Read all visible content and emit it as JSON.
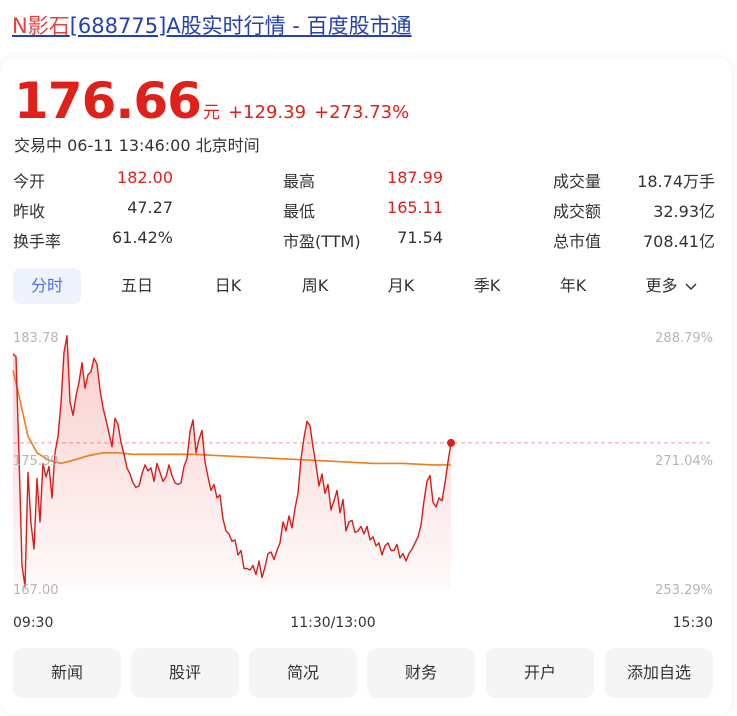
{
  "page": {
    "link_brand": "N影石",
    "link_rest": "[688775]A股实时行情 - 百度股市通"
  },
  "quote": {
    "price": "176.66",
    "unit": "元",
    "change": "+129.39",
    "change_pct": "+273.73%",
    "status": "交易中 06-11 13:46:00 北京时间"
  },
  "stats": [
    {
      "label": "今开",
      "value": "182.00"
    },
    {
      "label": "最高",
      "value": "187.99"
    },
    {
      "label": "成交量",
      "value": "18.74万手"
    },
    {
      "label": "昨收",
      "value": "47.27"
    },
    {
      "label": "最低",
      "value": "165.11"
    },
    {
      "label": "成交额",
      "value": "32.93亿"
    },
    {
      "label": "换手率",
      "value": "61.42%"
    },
    {
      "label": "市盈(TTM)",
      "value": "71.54"
    },
    {
      "label": "总市值",
      "value": "708.41亿"
    }
  ],
  "tabs": [
    "分时",
    "五日",
    "日K",
    "周K",
    "月K",
    "季K",
    "年K",
    "更多"
  ],
  "active_tab": "分时",
  "more_icon": "chevron-down-icon",
  "buttons": [
    "新闻",
    "股评",
    "简况",
    "财务",
    "开户",
    "添加自选"
  ],
  "colors": {
    "up": "#e0201b",
    "link": "#2440b3",
    "brand": "#e7413d",
    "avg_line": "#ee7d1f",
    "tab_active": "#4e6ef2",
    "tab_active_bg": "#eef3fe"
  },
  "chart_data": {
    "type": "line",
    "x_ticks": [
      "09:30",
      "11:30/13:00",
      "15:30"
    ],
    "y_left_ticks": [
      "183.78",
      "175.39",
      "167.00"
    ],
    "y_right_ticks": [
      "288.79%",
      "271.04%",
      "253.29%"
    ],
    "ylim": [
      167.0,
      183.78
    ],
    "reference_line": 175.39,
    "last_value": 176.66,
    "series": [
      {
        "kind": "price",
        "x": [
          0,
          1,
          2,
          3,
          4,
          5,
          6,
          7,
          8,
          9,
          10,
          11,
          12,
          13,
          14,
          15,
          16,
          17,
          18,
          19,
          20,
          21,
          22,
          23,
          24,
          25,
          26,
          27,
          28,
          29,
          30,
          31,
          32,
          33,
          34,
          35,
          36,
          37,
          38,
          39,
          40,
          41,
          42,
          43,
          44,
          45,
          46,
          47,
          48,
          49,
          50,
          51,
          52,
          53,
          54,
          55,
          56,
          57,
          58,
          59,
          60,
          61,
          62,
          63,
          64,
          65,
          66,
          67,
          68,
          69,
          70,
          71,
          72,
          73,
          74,
          75,
          76,
          77,
          78,
          79,
          80,
          81,
          82,
          83,
          84,
          85,
          86,
          87,
          88,
          89,
          90,
          91,
          92,
          93,
          94,
          95,
          96,
          97,
          98,
          99,
          100,
          101,
          102,
          103,
          104,
          105,
          106,
          107,
          108,
          109,
          110,
          111,
          112,
          113,
          114,
          115,
          116,
          117,
          118,
          119,
          120,
          121,
          122,
          123,
          124,
          125,
          126,
          127,
          128,
          129,
          130,
          131,
          132,
          133,
          134,
          135,
          136,
          137,
          138,
          139,
          140,
          141,
          142,
          143,
          144,
          145,
          146
        ],
        "values": [
          182.6,
          182.4,
          175.8,
          168.5,
          167.1,
          174.7,
          171.3,
          169.6,
          174.3,
          171.4,
          175.3,
          174.4,
          175.1,
          173.0,
          176.0,
          177.1,
          179.3,
          182.7,
          183.8,
          179.4,
          178.5,
          179.8,
          180.7,
          182.0,
          180.3,
          181.2,
          181.4,
          182.3,
          181.9,
          180.2,
          179.0,
          178.2,
          177.3,
          176.4,
          178.3,
          177.9,
          176.7,
          175.9,
          175.0,
          174.6,
          174.0,
          173.7,
          173.8,
          174.6,
          175.2,
          174.8,
          175.0,
          174.1,
          175.3,
          174.7,
          174.1,
          174.4,
          175.2,
          174.5,
          174.0,
          173.9,
          174.0,
          175.1,
          175.6,
          177.4,
          178.2,
          176.0,
          176.9,
          177.5,
          175.4,
          174.4,
          173.5,
          173.9,
          173.0,
          173.2,
          171.6,
          170.8,
          170.6,
          170.1,
          170.2,
          169.2,
          169.5,
          168.3,
          168.3,
          168.2,
          168.5,
          167.9,
          168.8,
          167.7,
          168.4,
          169.3,
          169.4,
          168.9,
          169.5,
          170.0,
          171.4,
          170.8,
          171.8,
          171.0,
          172.3,
          173.3,
          175.6,
          177.0,
          178.1,
          177.8,
          176.4,
          175.2,
          173.8,
          174.6,
          173.3,
          173.9,
          172.2,
          172.8,
          173.5,
          172.0,
          172.9,
          170.8,
          171.4,
          171.5,
          170.7,
          170.8,
          171.1,
          170.6,
          171.1,
          170.2,
          170.4,
          169.8,
          170.0,
          169.2,
          169.8,
          170.0,
          169.5,
          169.5,
          169.9,
          169.0,
          169.3,
          168.8,
          169.3,
          169.6,
          170.0,
          170.4,
          171.2,
          172.8,
          174.1,
          174.5,
          172.7,
          172.4,
          173.0,
          172.8,
          174.0,
          175.4,
          176.66
        ]
      },
      {
        "kind": "average",
        "x": [
          0,
          2,
          5,
          8,
          12,
          16,
          20,
          25,
          30,
          35,
          40,
          50,
          60,
          70,
          80,
          90,
          100,
          110,
          120,
          130,
          140,
          146
        ],
        "values": [
          181.5,
          179.8,
          177.1,
          176.0,
          175.5,
          175.3,
          175.5,
          175.8,
          176.0,
          176.0,
          175.9,
          175.9,
          175.9,
          175.8,
          175.7,
          175.6,
          175.5,
          175.4,
          175.3,
          175.3,
          175.2,
          175.2
        ]
      }
    ]
  }
}
